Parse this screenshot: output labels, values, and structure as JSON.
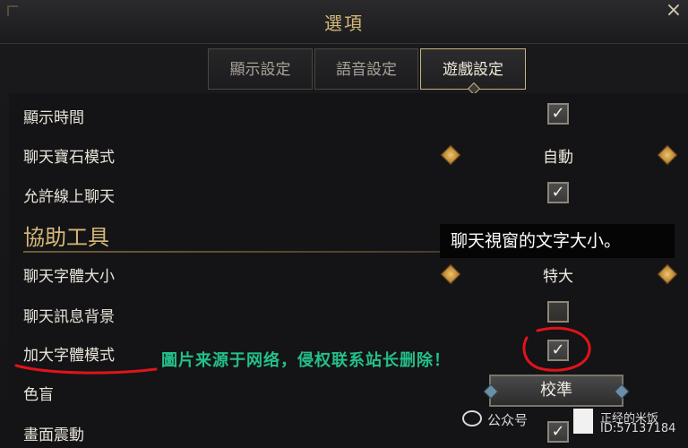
{
  "window": {
    "title": "選項",
    "close_glyph": "×"
  },
  "tabs": [
    {
      "label": "顯示設定",
      "active": false
    },
    {
      "label": "語音設定",
      "active": false
    },
    {
      "label": "遊戲設定",
      "active": true
    }
  ],
  "rows": {
    "show_time": {
      "label": "顯示時間",
      "checked": true
    },
    "chat_gem_mode": {
      "label": "聊天寶石模式",
      "value": "自動"
    },
    "allow_online_chat": {
      "label": "允許線上聊天",
      "checked": true
    },
    "section_assist": "協助工具",
    "chat_font_size": {
      "label": "聊天字體大小",
      "value": "特大"
    },
    "chat_bg": {
      "label": "聊天訊息背景",
      "checked": false
    },
    "large_font_mode": {
      "label": "加大字體模式",
      "checked": true
    },
    "colorblind": {
      "label": "色盲",
      "button_label": "校準"
    },
    "screen_shake": {
      "label": "畫面震動",
      "checked": true
    }
  },
  "tooltip": "聊天視窗的文字大小。",
  "watermark": "圖片来源于网络，侵权联系站长删除！",
  "wechat": {
    "prefix": "公众号",
    "name": "正经的米饭",
    "id": "ID:57137184"
  },
  "colors": {
    "gold": "#d6b978",
    "tab_active_border": "#c8b27c",
    "watermark_green": "#23c08a",
    "annotation_red": "#e0141a"
  }
}
